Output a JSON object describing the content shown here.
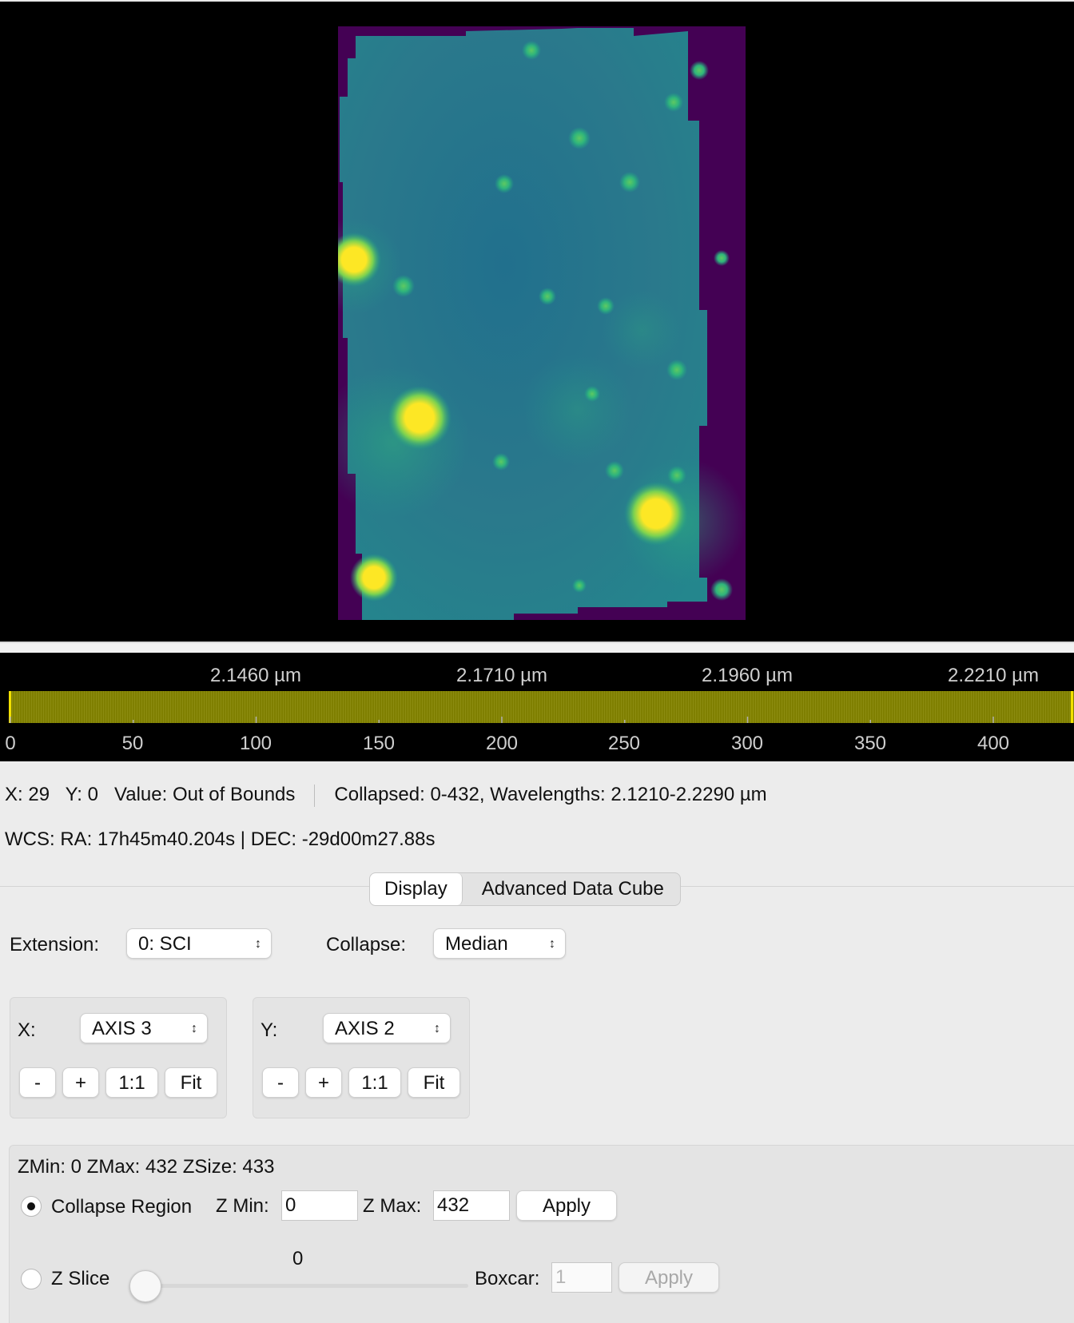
{
  "wavelength_axis": {
    "top_labels": [
      "2.1460 µm",
      "2.1710 µm",
      "2.1960 µm",
      "2.2210 µm"
    ],
    "bottom_labels": [
      "0",
      "50",
      "100",
      "150",
      "200",
      "250",
      "300",
      "350",
      "400"
    ]
  },
  "status": {
    "x_readout": "X: 29",
    "y_readout": "Y: 0",
    "value_readout": "Value: Out of Bounds",
    "collapsed_info": "Collapsed: 0-432, Wavelengths: 2.1210-2.2290 µm",
    "wcs": "WCS: RA: 17h45m40.204s  |  DEC: -29d00m27.88s"
  },
  "tabs": [
    "Display",
    "Advanced Data Cube"
  ],
  "extension": {
    "label": "Extension:",
    "value": "0: SCI"
  },
  "collapse": {
    "label": "Collapse:",
    "value": "Median"
  },
  "x_axis": {
    "label": "X:",
    "value": "AXIS 3",
    "buttons": [
      "-",
      "+",
      "1:1",
      "Fit"
    ]
  },
  "y_axis": {
    "label": "Y:",
    "value": "AXIS 2",
    "buttons": [
      "-",
      "+",
      "1:1",
      "Fit"
    ]
  },
  "z_panel": {
    "info": "ZMin: 0 ZMax: 432 ZSize: 433",
    "collapse_region_label": "Collapse Region",
    "zmin_label": "Z Min:",
    "zmin_value": "0",
    "zmax_label": "Z Max:",
    "zmax_value": "432",
    "apply_label": "Apply",
    "zslice_label": "Z Slice",
    "slider_value": "0",
    "boxcar_label": "Boxcar:",
    "boxcar_value": "1",
    "boxcar_apply_label": "Apply"
  },
  "colors": {
    "viridis_dark": "#440154",
    "viridis_teal": "#2a788e",
    "viridis_yellow": "#fde725",
    "band_olive": "#7f7f00"
  }
}
